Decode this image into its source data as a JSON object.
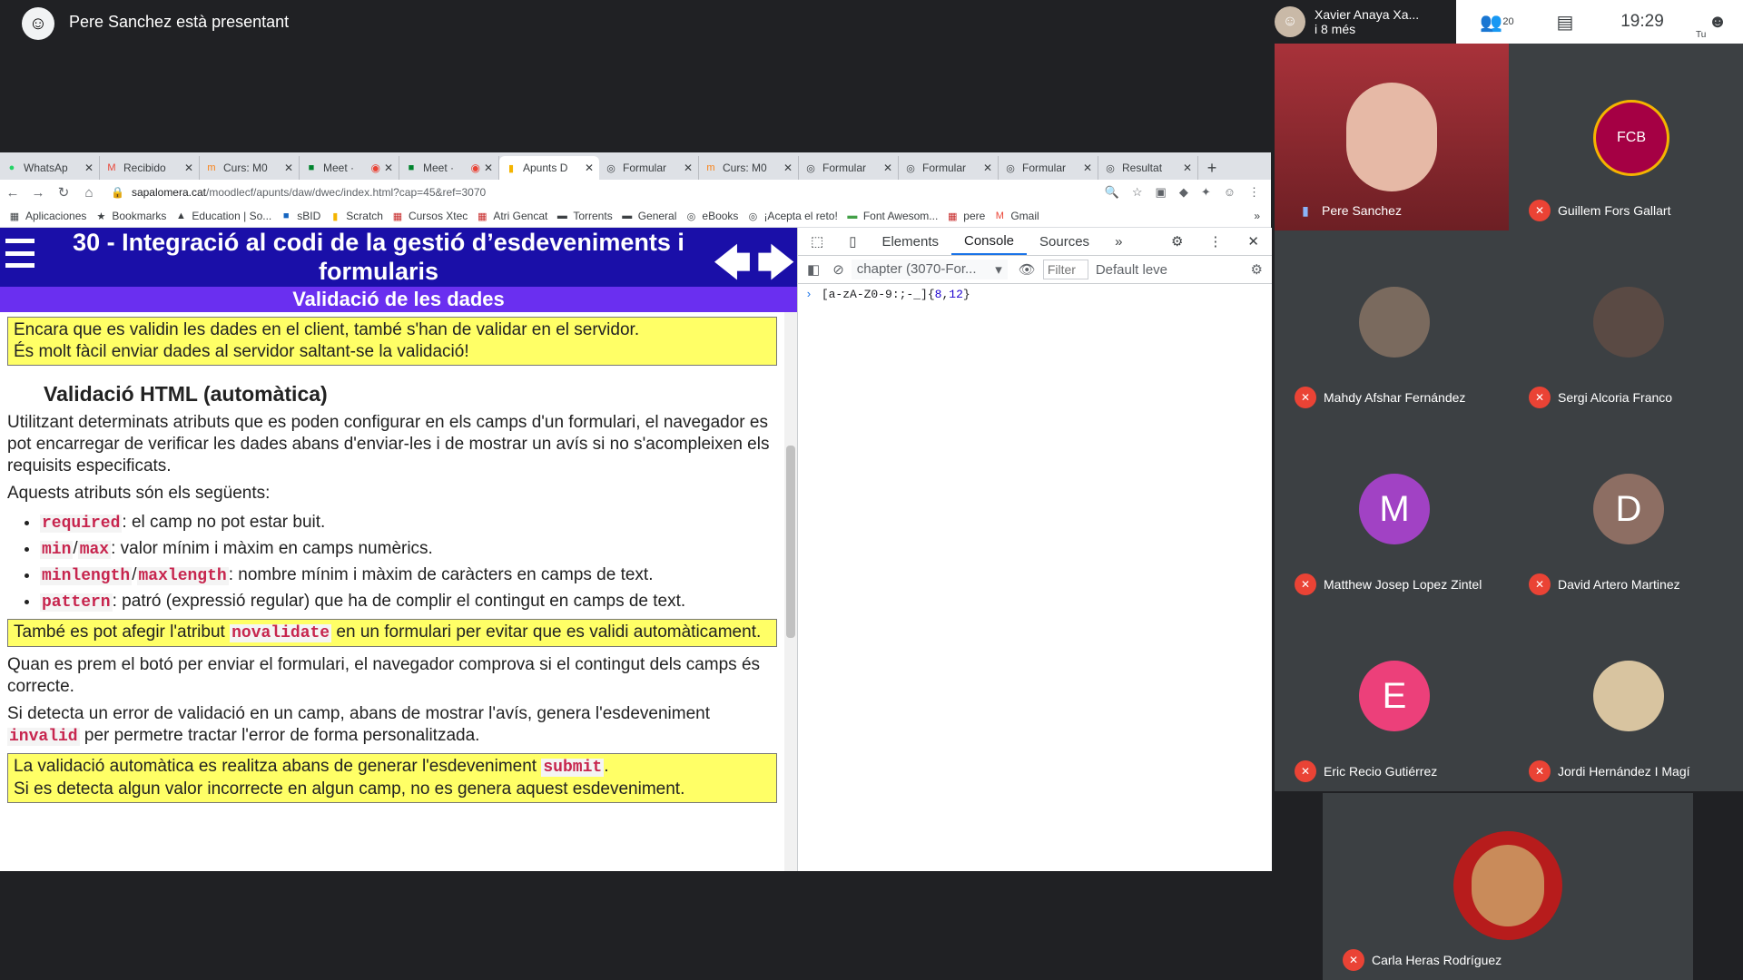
{
  "meet": {
    "presenting_label": "Pere Sanchez està presentant",
    "header_name": "Xavier Anaya Xa...",
    "header_more": "i 8 més",
    "participant_count": "20",
    "time": "19:29",
    "self_label": "Tu"
  },
  "browser": {
    "tabs": [
      {
        "label": "WhatsAp",
        "icon": "whatsapp-icon"
      },
      {
        "label": "Recibido",
        "icon": "gmail-icon"
      },
      {
        "label": "Curs: M0",
        "icon": "moodle-icon"
      },
      {
        "label": "Meet ·",
        "icon": "meet-icon"
      },
      {
        "label": "Meet ·",
        "icon": "meet-icon"
      },
      {
        "label": "Apunts D",
        "icon": "bookmark-icon"
      },
      {
        "label": "Formular",
        "icon": "globe-icon"
      },
      {
        "label": "Curs: M0",
        "icon": "moodle-icon"
      },
      {
        "label": "Formular",
        "icon": "globe-icon"
      },
      {
        "label": "Formular",
        "icon": "globe-icon"
      },
      {
        "label": "Formular",
        "icon": "globe-icon"
      },
      {
        "label": "Resultat",
        "icon": "globe-icon"
      }
    ],
    "url_host": "sapalomera.cat",
    "url_path": "/moodlecf/apunts/daw/dwec/index.html?cap=45&ref=3070",
    "bookmarks": [
      "Aplicaciones",
      "Bookmarks",
      "Education | So...",
      "sBID",
      "Scratch",
      "Cursos Xtec",
      "Atri Gencat",
      "Torrents",
      "General",
      "eBooks",
      "¡Acepta el reto!",
      "Font Awesom...",
      "pere",
      "Gmail"
    ]
  },
  "page": {
    "title": "30 - Integració al codi de la gestió d’esdeveniments i formularis",
    "subtitle": "Validació de les dades",
    "note1_line1": "Encara que es validin les dades en el client, també s'han de validar en el servidor.",
    "note1_line2": "És molt fàcil enviar dades al servidor saltant-se la validació!",
    "section_title": "Validació HTML (automàtica)",
    "par1": "Utilitzant determinats atributs que es poden configurar en els camps d'un formulari, el navegador es pot encarregar de verificar les dades abans d'enviar-les i de mostrar un avís si no s'acompleixen els requisits especificats.",
    "par2": "Aquests atributs són els següents:",
    "attr_required": "required",
    "attr_required_desc": ": el camp no pot estar buit.",
    "attr_min": "min",
    "attr_sep": "/",
    "attr_max": "max",
    "attr_minmax_desc": ": valor mínim i màxim en camps numèrics.",
    "attr_minlength": "minlength",
    "attr_maxlength": "maxlength",
    "attr_length_desc": ": nombre mínim i màxim de caràcters en camps de text.",
    "attr_pattern": "pattern",
    "attr_pattern_desc": ": patró (expressió regular) que ha de complir el contingut en camps de text.",
    "note2_pre": "També es pot afegir l'atribut ",
    "note2_code": "novalidate",
    "note2_post": " en un formulari per evitar que es validi automàticament.",
    "par3": "Quan es prem el botó per enviar el formulari, el navegador comprova si el contingut dels camps és correcte.",
    "par4_pre": "Si detecta un error de validació en un camp, abans de mostrar l'avís, genera l'esdeveniment ",
    "par4_code": "invalid",
    "par4_post": " per permetre tractar l'error de forma personalitzada.",
    "note3_pre": "La validació automàtica es realitza abans de generar l'esdeveniment ",
    "note3_code": "submit",
    "note3_post": ".",
    "note3_line2": "Si es detecta algun valor incorrecte en algun camp, no es genera aquest esdeveniment."
  },
  "devtools": {
    "tabs": [
      "Elements",
      "Console",
      "Sources"
    ],
    "active_tab": "Console",
    "context": "chapter (3070-For...",
    "filter_placeholder": "Filter",
    "levels": "Default leve",
    "console_prefix": "[a-zA-Z0-9:;-_]{",
    "console_n1": "8",
    "console_comma": ",",
    "console_n2": "12",
    "console_suffix": "}"
  },
  "participants": [
    {
      "name": "Pere Sanchez",
      "muted": false,
      "initial": "",
      "color": "#8b2b2b"
    },
    {
      "name": "Guillem Fors Gallart",
      "muted": true,
      "initial": "",
      "color": "#a50044"
    },
    {
      "name": "Mahdy Afshar Fernández",
      "muted": true,
      "initial": "",
      "color": "#7a6a5e"
    },
    {
      "name": "Sergi Alcoria Franco",
      "muted": true,
      "initial": "",
      "color": "#5a4a44"
    },
    {
      "name": "Matthew Josep Lopez Zintel",
      "muted": true,
      "initial": "M",
      "color": "#a142c4"
    },
    {
      "name": "David Artero Martinez",
      "muted": true,
      "initial": "D",
      "color": "#8d6e63"
    },
    {
      "name": "Eric Recio Gutiérrez",
      "muted": true,
      "initial": "E",
      "color": "#ec407a"
    },
    {
      "name": "Jordi Hernández I Magí",
      "muted": true,
      "initial": "",
      "color": "#d8c4a0"
    },
    {
      "name": "Carla Heras Rodríguez",
      "muted": true,
      "initial": "",
      "color": "#b71c1c"
    }
  ],
  "colors": {
    "page_header": "#1a0fa8",
    "subtitle_bar": "#6a2ff0",
    "note_bg": "#ffff66",
    "code_color": "#c7254e",
    "mic_off": "#ea4335"
  }
}
